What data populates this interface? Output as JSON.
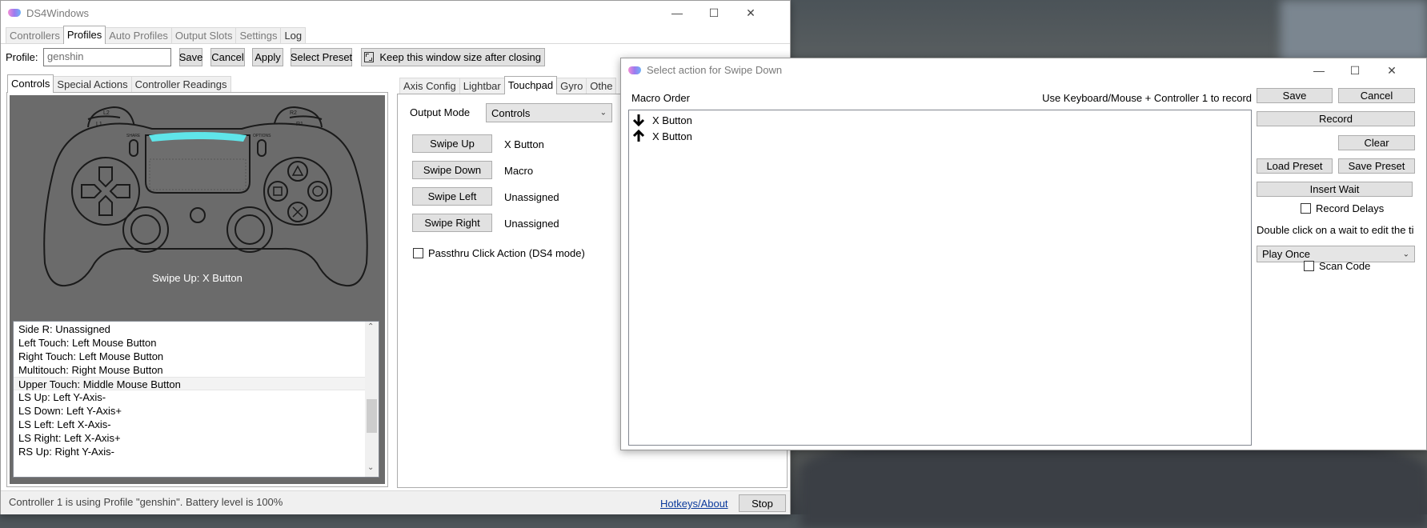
{
  "main": {
    "title": "DS4Windows",
    "tabs": [
      {
        "label": "Controllers"
      },
      {
        "label": "Profiles"
      },
      {
        "label": "Auto Profiles"
      },
      {
        "label": "Output Slots"
      },
      {
        "label": "Settings"
      },
      {
        "label": "Log"
      }
    ],
    "profile_label": "Profile:",
    "profile_value": "genshin",
    "save": "Save",
    "cancel": "Cancel",
    "apply": "Apply",
    "select_preset": "Select Preset",
    "keep_size": "Keep this window size after closing",
    "left_tabs": [
      {
        "label": "Controls"
      },
      {
        "label": "Special Actions"
      },
      {
        "label": "Controller Readings"
      }
    ],
    "controller_caption": "Swipe Up: X Button",
    "controller_labels": {
      "l2": "L2",
      "l1": "L1",
      "r2": "R2",
      "r1": "R1",
      "share": "SHARE",
      "options": "OPTIONS"
    },
    "list_items": [
      "Side R: Unassigned",
      "Left Touch: Left Mouse Button",
      "Right Touch: Left Mouse Button",
      "Multitouch: Right Mouse Button",
      "Upper Touch: Middle Mouse Button",
      "LS Up: Left Y-Axis-",
      "LS Down: Left Y-Axis+",
      "LS Left: Left X-Axis-",
      "LS Right: Left X-Axis+",
      "RS Up: Right Y-Axis-"
    ],
    "right_tabs": [
      {
        "label": "Axis Config"
      },
      {
        "label": "Lightbar"
      },
      {
        "label": "Touchpad"
      },
      {
        "label": "Gyro"
      },
      {
        "label": "Othe"
      }
    ],
    "output_mode_label": "Output Mode",
    "output_mode_value": "Controls",
    "swipes": [
      {
        "button": "Swipe Up",
        "value": "X Button"
      },
      {
        "button": "Swipe Down",
        "value": "Macro"
      },
      {
        "button": "Swipe Left",
        "value": "Unassigned"
      },
      {
        "button": "Swipe Right",
        "value": "Unassigned"
      }
    ],
    "passthru": "Passthru Click Action (DS4 mode)",
    "status": "Controller 1 is using Profile \"genshin\". Battery level is 100%",
    "hotkeys": "Hotkeys/About",
    "stop": "Stop"
  },
  "dialog": {
    "title": "Select action for Swipe Down",
    "macro_order": "Macro Order",
    "record_hint": "Use Keyboard/Mouse + Controller 1 to record",
    "macro_items": [
      {
        "icon": "arrow-down-icon",
        "label": "X Button"
      },
      {
        "icon": "arrow-up-icon",
        "label": "X Button"
      }
    ],
    "save": "Save",
    "cancel": "Cancel",
    "record": "Record",
    "clear": "Clear",
    "load_preset": "Load Preset",
    "save_preset": "Save Preset",
    "insert_wait": "Insert Wait",
    "record_delays": "Record Delays",
    "wait_hint": "Double click on a wait to edit the ti",
    "play_mode": "Play Once",
    "scan_code": "Scan Code"
  },
  "colors": {
    "lightbar": "#5fe5e9",
    "controller_bg": "#6b6b6b",
    "button_face": "#e1e1e1"
  }
}
